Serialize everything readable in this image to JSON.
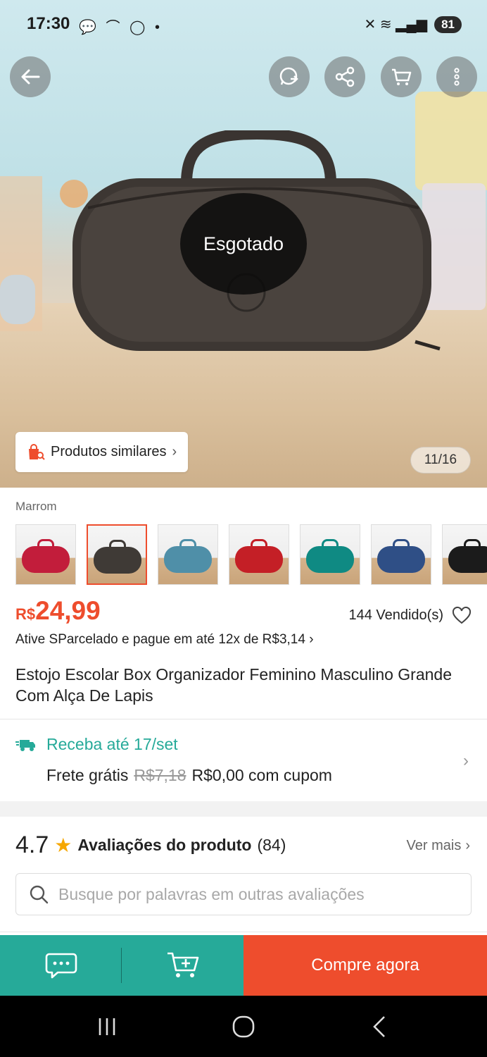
{
  "status_bar": {
    "time": "17:30",
    "notification_icons": "💬 ⌒ ◯ •",
    "signal_icons": "✕ ≋ ▂▄▆",
    "battery": "81"
  },
  "header": {
    "icons": [
      "back-icon",
      "whatsapp-share-icon",
      "share-icon",
      "cart-icon",
      "more-icon"
    ]
  },
  "hero": {
    "sold_out_label": "Esgotado",
    "similar_label": "Produtos similares",
    "image_counter": "11/16"
  },
  "variants": {
    "selected_label": "Marrom",
    "colors": [
      "#c21d3b",
      "#3f3a36",
      "#4f8fa8",
      "#c41f26",
      "#0f8a83",
      "#2f4f86",
      "#1b1b1b"
    ]
  },
  "price": {
    "currency": "R$",
    "value": "24,99",
    "sold": "144 Vendido(s)",
    "installments": "Ative SParcelado e pague em até 12x de R$3,14 ›"
  },
  "product": {
    "title": "Estojo Escolar Box Organizador Feminino Masculino Grande Com Alça De Lapis"
  },
  "shipping": {
    "title": "Receba até 17/set",
    "free_label": "Frete grátis",
    "old_price": "R$7,18",
    "new_price": "R$0,00 com cupom"
  },
  "reviews": {
    "score": "4.7",
    "label": "Avaliações do produto",
    "count": "(84)",
    "see_more": "Ver mais",
    "search_placeholder": "Busque por palavras em outras avaliações"
  },
  "actions": {
    "buy_label": "Compre agora"
  },
  "colors": {
    "accent": "#ee4d2d",
    "teal": "#26aa99"
  }
}
